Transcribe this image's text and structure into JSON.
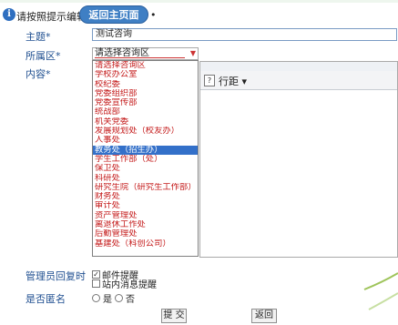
{
  "header": {
    "title": "请按照提示编辑",
    "back_button": "返回主页面",
    "dot": "•"
  },
  "form": {
    "subject_label": "主题*",
    "subject_value": "测试咨询",
    "district_label": "所属区*",
    "district_value": "请选择咨询区",
    "content_label": "内容*",
    "reply_label": "管理员回复时",
    "anonymous_label": "是否匿名"
  },
  "editor": {
    "help_icon": "?",
    "line_spacing": "行距 ▾"
  },
  "dropdown_options": [
    "请选择咨询区",
    "学校办公室",
    "校纪委",
    "党委组织部",
    "党委宣传部",
    "统战部",
    "机关党委",
    "发展规划处（校友办）",
    "人事处",
    "教务处（招生办）",
    "学生工作部（处）",
    "保卫处",
    "科研处",
    "研究生院（研究生工作部）",
    "财务处",
    "审计处",
    "资产管理处",
    "离退休工作处",
    "后勤管理处",
    "基建处（科创公司）"
  ],
  "dropdown_selected_index": 9,
  "reply": {
    "email_label": "邮件提醒",
    "email_checked": true,
    "site_msg_label": "站内消息提醒",
    "site_msg_checked": false
  },
  "anonymous": {
    "yes": "是",
    "no": "否"
  },
  "buttons": {
    "submit": "提 交",
    "back": "返回"
  },
  "colors": {
    "accent_blue": "#3f7fc4",
    "label_blue": "#1f4f90",
    "option_red": "#c41a1a",
    "selected_bg": "#3370c9"
  }
}
